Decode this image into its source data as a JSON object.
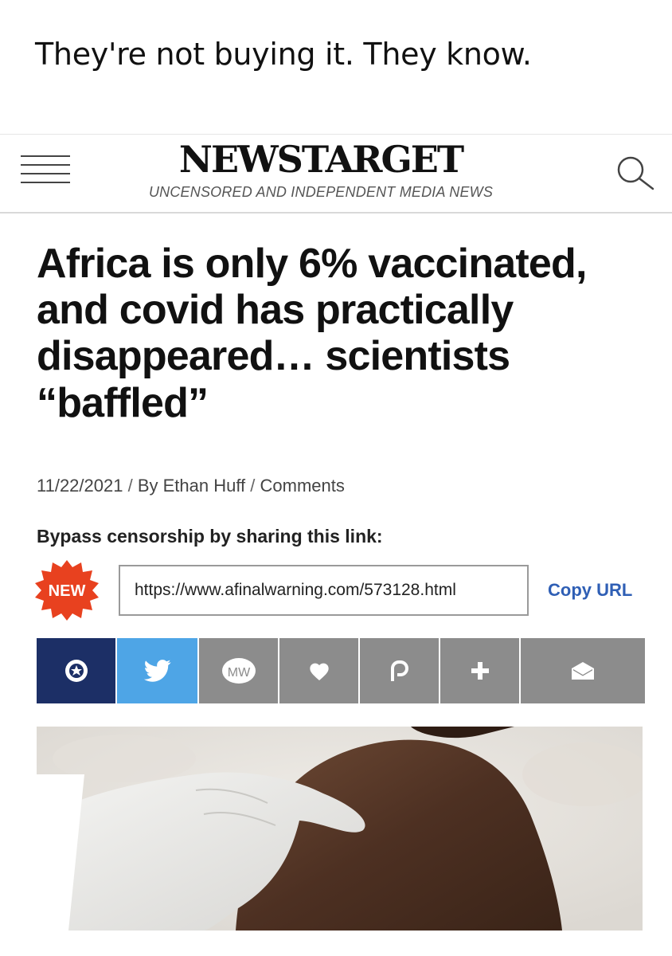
{
  "caption": "They're not buying it. They know.",
  "site": {
    "logo": "NEWSTARGET",
    "tagline": "UNCENSORED AND INDEPENDENT MEDIA NEWS"
  },
  "article": {
    "headline": "Africa is only 6% vaccinated, and covid has practically disappeared… scientists “baffled”",
    "date": "11/22/2021",
    "author": "By Ethan Huff",
    "comments_label": "Comments",
    "separator": " / "
  },
  "bypass": {
    "label": "Bypass censorship by sharing this link:",
    "badge": "NEW",
    "url": "https://www.afinalwarning.com/573128.html",
    "copy_label": "Copy URL"
  },
  "share": {
    "mewe_text": "MW",
    "buttons": [
      {
        "name": "brighteon",
        "icon": "brighteon-icon",
        "color": "#1c2f66"
      },
      {
        "name": "twitter",
        "icon": "twitter-icon",
        "color": "#4ea5e6"
      },
      {
        "name": "mewe",
        "icon": "mewe-icon",
        "color": "#8c8c8c"
      },
      {
        "name": "favorite",
        "icon": "heart-icon",
        "color": "#8c8c8c"
      },
      {
        "name": "parler",
        "icon": "parler-icon",
        "color": "#8c8c8c"
      },
      {
        "name": "more",
        "icon": "plus-icon",
        "color": "#8c8c8c"
      },
      {
        "name": "email",
        "icon": "envelope-icon",
        "color": "#8c8c8c"
      }
    ]
  },
  "colors": {
    "link_blue": "#2f5fb5",
    "badge_red": "#e8411f",
    "share_gray": "#8c8c8c"
  }
}
